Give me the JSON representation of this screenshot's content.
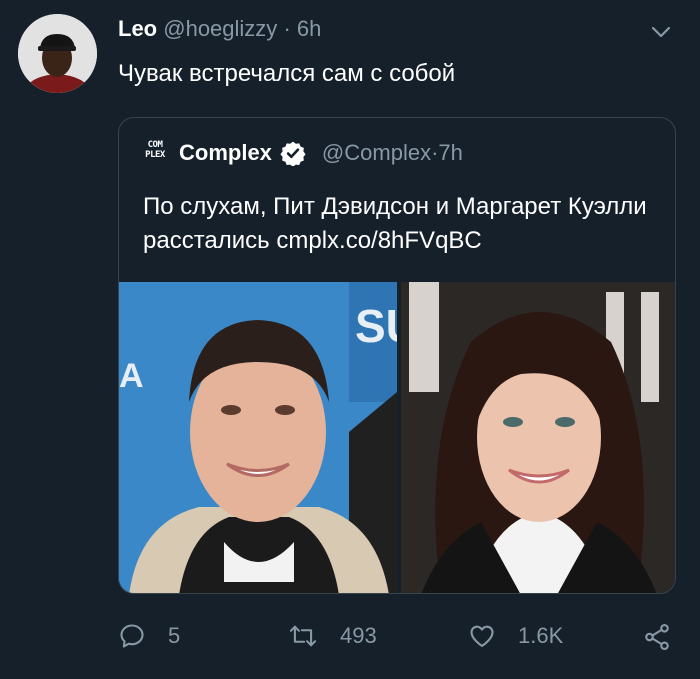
{
  "tweet": {
    "name": "Leo",
    "handle": "@hoeglizzy",
    "separator": "·",
    "time": "6h",
    "text": "Чувак встречался сам с собой"
  },
  "quote": {
    "logo_text": "COM PLEX",
    "name": "Complex",
    "handle": "@Complex",
    "separator": "·",
    "time": "7h",
    "text": "По слухам, Пит Дэвидсон и Маргарет Куэлли расстались cmplx.co/8hFVqBC"
  },
  "actions": {
    "reply_count": "5",
    "retweet_count": "493",
    "like_count": "1.6K"
  },
  "icons": {
    "more": "chevron-down-icon",
    "verified": "verified-badge-icon",
    "reply": "reply-icon",
    "retweet": "retweet-icon",
    "like": "heart-icon",
    "share": "share-icon"
  },
  "colors": {
    "background": "#15202b",
    "secondary_text": "#8899a6",
    "border": "#38444d"
  }
}
